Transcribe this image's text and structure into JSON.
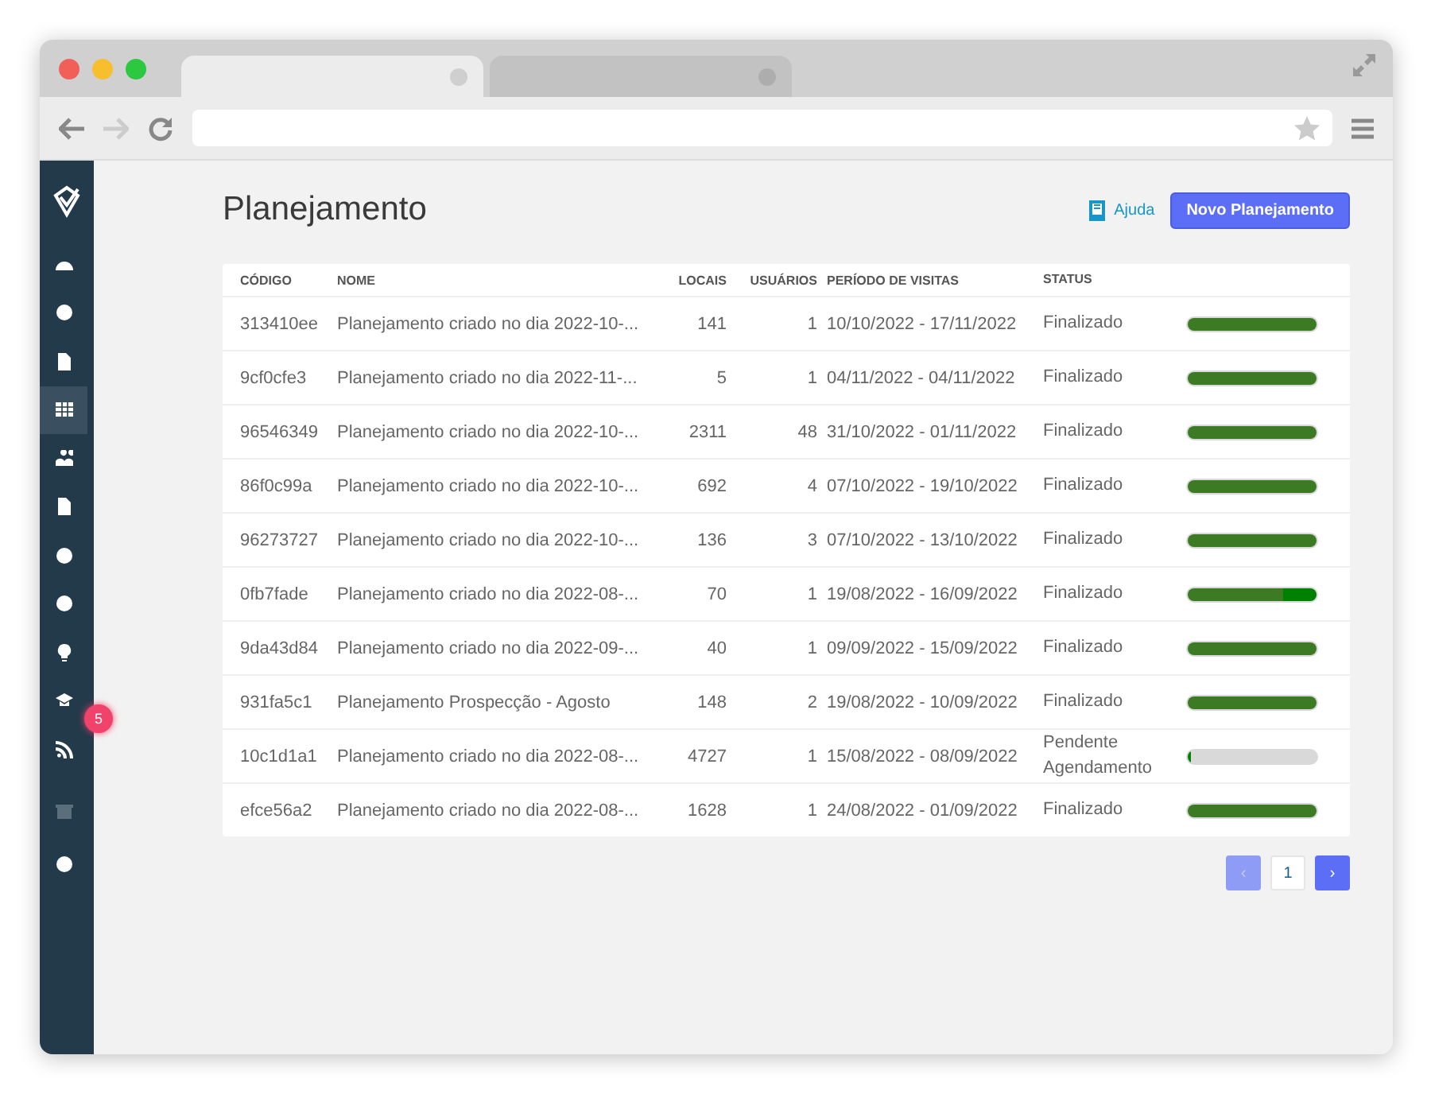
{
  "browser": {
    "tabs": [
      {
        "selected": true
      },
      {
        "selected": false
      }
    ]
  },
  "sidebar": {
    "items": [
      {
        "selected": false,
        "disabled": false
      },
      {
        "selected": false,
        "disabled": false
      },
      {
        "selected": false,
        "disabled": false
      },
      {
        "selected": true,
        "disabled": false
      },
      {
        "selected": false,
        "disabled": false
      },
      {
        "selected": false,
        "disabled": false
      },
      {
        "selected": false,
        "disabled": false
      },
      {
        "selected": false,
        "disabled": false
      },
      {
        "selected": false,
        "disabled": false
      },
      {
        "selected": false,
        "disabled": false
      },
      {
        "selected": false,
        "disabled": false
      },
      {
        "selected": false,
        "disabled": true
      },
      {
        "selected": false,
        "disabled": false
      }
    ],
    "badge": "5"
  },
  "page": {
    "title": "Planejamento",
    "help_link": "Ajuda",
    "new_button": "Novo Planejamento"
  },
  "table": {
    "columns": [
      "CÓDIGO",
      "NOME",
      "LOCAIS",
      "USUÁRIOS",
      "PERÍODO DE VISITAS",
      "STATUS"
    ],
    "rows": [
      {
        "code": "313410ee",
        "name": "Planejamento criado no dia 2022-10-...",
        "locais": "141",
        "usuarios": "1",
        "periodo": "10/10/2022 - 17/11/2022",
        "status": "Finalizado",
        "progress": [
          {
            "level": 1,
            "color": "#3d7a24"
          }
        ]
      },
      {
        "code": "9cf0cfe3",
        "name": "Planejamento criado no dia 2022-11-...",
        "locais": "5",
        "usuarios": "1",
        "periodo": "04/11/2022 - 04/11/2022",
        "status": "Finalizado",
        "progress": [
          {
            "level": 1,
            "color": "#3d7a24"
          }
        ]
      },
      {
        "code": "96546349",
        "name": "Planejamento criado no dia 2022-10-...",
        "locais": "2311",
        "usuarios": "48",
        "periodo": "31/10/2022 - 01/11/2022",
        "status": "Finalizado",
        "progress": [
          {
            "level": 1,
            "color": "#3d7a24"
          }
        ]
      },
      {
        "code": "86f0c99a",
        "name": "Planejamento criado no dia 2022-10-...",
        "locais": "692",
        "usuarios": "4",
        "periodo": "07/10/2022 - 19/10/2022",
        "status": "Finalizado",
        "progress": [
          {
            "level": 1,
            "color": "#3d7a24"
          }
        ]
      },
      {
        "code": "96273727",
        "name": "Planejamento criado no dia 2022-10-...",
        "locais": "136",
        "usuarios": "3",
        "periodo": "07/10/2022 - 13/10/2022",
        "status": "Finalizado",
        "progress": [
          {
            "level": 1,
            "color": "#3d7a24"
          }
        ]
      },
      {
        "code": "0fb7fade",
        "name": "Planejamento criado no dia 2022-08-...",
        "locais": "70",
        "usuarios": "1",
        "periodo": "19/08/2022 - 16/09/2022",
        "status": "Finalizado",
        "progress": [
          {
            "level": 0.74,
            "color": "#3d7a24"
          },
          {
            "level": 0.26,
            "color": "#008000"
          }
        ]
      },
      {
        "code": "9da43d84",
        "name": "Planejamento criado no dia 2022-09-...",
        "locais": "40",
        "usuarios": "1",
        "periodo": "09/09/2022 - 15/09/2022",
        "status": "Finalizado",
        "progress": [
          {
            "level": 1,
            "color": "#3d7a24"
          }
        ]
      },
      {
        "code": "931fa5c1",
        "name": "Planejamento Prospecção - Agosto",
        "locais": "148",
        "usuarios": "2",
        "periodo": "19/08/2022 - 10/09/2022",
        "status": "Finalizado",
        "progress": [
          {
            "level": 1,
            "color": "#3d7a24"
          }
        ]
      },
      {
        "code": "10c1d1a1",
        "name": "Planejamento criado no dia 2022-08-...",
        "locais": "4727",
        "usuarios": "1",
        "periodo": "15/08/2022 - 08/09/2022",
        "status": "Pendente Agendamento",
        "progress": [
          {
            "level": 0.03,
            "color": "#008000"
          }
        ]
      },
      {
        "code": "efce56a2",
        "name": "Planejamento criado no dia 2022-08-...",
        "locais": "1628",
        "usuarios": "1",
        "periodo": "24/08/2022 - 01/09/2022",
        "status": "Finalizado",
        "progress": [
          {
            "level": 1,
            "color": "#3d7a24"
          }
        ]
      }
    ]
  },
  "pagination": {
    "prev": "‹",
    "prev_disabled": true,
    "pages": [
      {
        "label": "1",
        "selected": true
      }
    ],
    "next": "›"
  }
}
